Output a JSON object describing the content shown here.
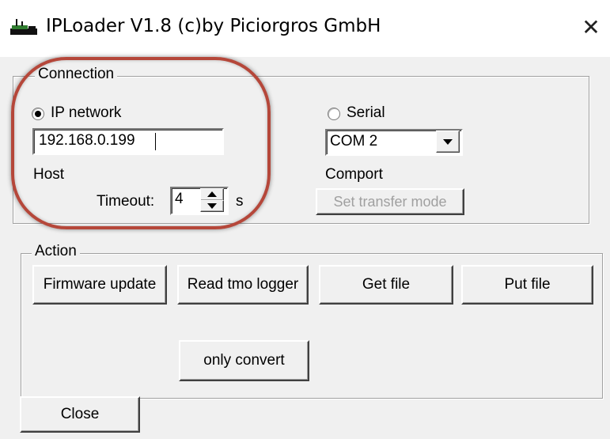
{
  "window": {
    "title": "IPLoader V1.8 (c)by Piciorgros GmbH",
    "app_icon": "network-device-icon",
    "close_glyph": "✕"
  },
  "connection": {
    "legend": "Connection",
    "ip_radio_label": "IP network",
    "ip_selected": true,
    "host_value": "192.168.0.199",
    "host_label": "Host",
    "timeout_label": "Timeout:",
    "timeout_value": "4",
    "timeout_unit": "s",
    "serial_radio_label": "Serial",
    "serial_selected": false,
    "comport_value": "COM 2",
    "comport_label": "Comport",
    "set_transfer_mode_label": "Set transfer mode"
  },
  "action": {
    "legend": "Action",
    "buttons": {
      "firmware_update": "Firmware update",
      "read_tmo_logger": "Read tmo logger",
      "get_file": "Get file",
      "put_file": "Put file",
      "only_convert": "only convert"
    }
  },
  "footer": {
    "close_label": "Close"
  },
  "colors": {
    "highlight_ring": "#b5473a",
    "window_bg": "#f0f0f0"
  }
}
